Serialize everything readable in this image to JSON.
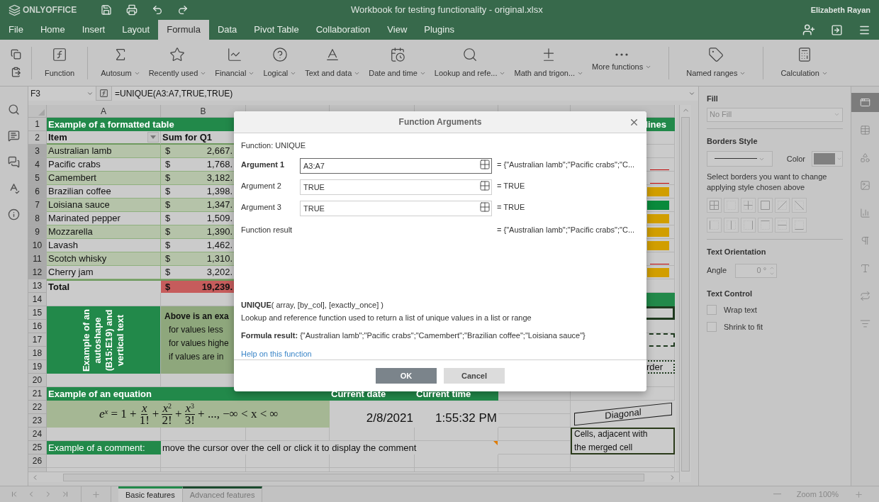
{
  "title_bar": {
    "logo": "ONLYOFFICE",
    "title": "Workbook for testing functionality - original.xlsx",
    "user": "Elizabeth Rayan"
  },
  "menu_tabs": [
    {
      "label": "File",
      "selected": false
    },
    {
      "label": "Home",
      "selected": false
    },
    {
      "label": "Insert",
      "selected": false
    },
    {
      "label": "Layout",
      "selected": false
    },
    {
      "label": "Formula",
      "selected": true
    },
    {
      "label": "Data",
      "selected": false
    },
    {
      "label": "Pivot Table",
      "selected": false
    },
    {
      "label": "Collaboration",
      "selected": false
    },
    {
      "label": "View",
      "selected": false
    },
    {
      "label": "Plugins",
      "selected": false
    }
  ],
  "toolbar": [
    {
      "label": "Function",
      "dropdown": false
    },
    {
      "label": "Autosum",
      "dropdown": true
    },
    {
      "label": "Recently used",
      "dropdown": true
    },
    {
      "label": "Financial",
      "dropdown": true
    },
    {
      "label": "Logical",
      "dropdown": true
    },
    {
      "label": "Text and data",
      "dropdown": true
    },
    {
      "label": "Date and time",
      "dropdown": true
    },
    {
      "label": "Lookup and refe...",
      "dropdown": true
    },
    {
      "label": "Math and trigon...",
      "dropdown": true
    },
    {
      "label": "More functions",
      "dropdown": true
    },
    {
      "label": "Named ranges",
      "dropdown": true
    },
    {
      "label": "Calculation",
      "dropdown": true
    }
  ],
  "formula_bar": {
    "cell": "F3",
    "formula": "=UNIQUE(A3:A7,TRUE,TRUE)"
  },
  "sheet": {
    "columns": [
      {
        "label": "A"
      },
      {
        "label": "B"
      }
    ],
    "rows": [
      {
        "label": "1",
        "selected": false
      },
      {
        "label": "2",
        "selected": false
      },
      {
        "label": "3",
        "selected": true
      },
      {
        "label": "4",
        "selected": true
      },
      {
        "label": "5",
        "selected": true
      },
      {
        "label": "6",
        "selected": true
      },
      {
        "label": "7",
        "selected": true
      },
      {
        "label": "8",
        "selected": true
      },
      {
        "label": "9",
        "selected": true
      },
      {
        "label": "10",
        "selected": true
      },
      {
        "label": "11",
        "selected": true
      },
      {
        "label": "12",
        "selected": true
      },
      {
        "label": "13",
        "selected": false
      },
      {
        "label": "14",
        "selected": false
      },
      {
        "label": "15",
        "selected": false
      },
      {
        "label": "16",
        "selected": false
      },
      {
        "label": "17",
        "selected": false
      },
      {
        "label": "18",
        "selected": false
      },
      {
        "label": "19",
        "selected": false
      },
      {
        "label": "20",
        "selected": false
      },
      {
        "label": "21",
        "selected": false
      },
      {
        "label": "22",
        "selected": false
      },
      {
        "label": "23",
        "selected": false
      },
      {
        "label": "24",
        "selected": false
      },
      {
        "label": "25",
        "selected": false
      },
      {
        "label": "26",
        "selected": false
      }
    ],
    "table_title": "Example of a formatted table",
    "g_heading": "lines",
    "header": {
      "item": "Item",
      "sum": "Sum for Q1"
    },
    "items": [
      {
        "name": "Australian lamb",
        "currency": "$",
        "amount": "2,667."
      },
      {
        "name": "Pacific crabs",
        "currency": "$",
        "amount": "1,768.",
        "g_mark": {
          "kind": "line",
          "color": "#c00000"
        }
      },
      {
        "name": "Camembert",
        "currency": "$",
        "amount": "3,182.",
        "g_mark": {
          "kind": "line",
          "color": "#c00000"
        }
      },
      {
        "name": "Brazilian coffee",
        "currency": "$",
        "amount": "1,398.",
        "g_mark": {
          "kind": "bar",
          "color": "#d19e00"
        }
      },
      {
        "name": "Loisiana sauce",
        "currency": "$",
        "amount": "1,347.",
        "g_mark": {
          "kind": "bar",
          "color": "#0a8a3c"
        }
      },
      {
        "name": "Marinated pepper",
        "currency": "$",
        "amount": "1,509.",
        "g_mark": {
          "kind": "bar",
          "color": "#d19e00"
        }
      },
      {
        "name": "Mozzarella",
        "currency": "$",
        "amount": "1,390.",
        "g_mark": {
          "kind": "bar",
          "color": "#d19e00"
        }
      },
      {
        "name": "Lavash",
        "currency": "$",
        "amount": "1,462.",
        "g_mark": {
          "kind": "bar",
          "color": "#d19e00"
        }
      },
      {
        "name": "Scotch whisky",
        "currency": "$",
        "amount": "1,310.",
        "g_mark": {
          "kind": "line",
          "color": "#c00000"
        }
      },
      {
        "name": "Cherry jam",
        "currency": "$",
        "amount": "3,202.",
        "g_mark": {
          "kind": "bar",
          "color": "#d19e00"
        }
      }
    ],
    "total": {
      "label": "Total",
      "currency": "$",
      "amount": "19,239."
    },
    "g_borders": [
      {
        "kind": "fill"
      },
      {
        "kind": "thick"
      },
      {
        "kind": "dashed"
      },
      {
        "kind": "dash-dot",
        "text": "rder"
      }
    ],
    "vertical_text": "Example of an autoshape (B15:E19) and vertical text",
    "autoshape_lines": [
      {
        "text": "Above is an exa",
        "bold": true
      },
      {
        "text": "for values less",
        "bold": false
      },
      {
        "text": "for values highe",
        "bold": false
      },
      {
        "text": "if values are in",
        "bold": false
      }
    ],
    "equation_heading": "Example of an equation",
    "date_heading": "Current date",
    "time_heading": "Current time",
    "equation": {
      "base": "e",
      "power": "x",
      "lead": "= 1 +",
      "fractions": [
        {
          "num": "x",
          "den": "1!",
          "after": "+"
        },
        {
          "num": "x",
          "exp": "2",
          "den": "2!",
          "after": "+"
        },
        {
          "num": "x",
          "exp": "3",
          "den": "3!",
          "after": "+ ...,  −∞ < x < ∞"
        }
      ]
    },
    "date": "2/8/2021",
    "time": "1:55:32 PM",
    "diagonal": "Diagonal",
    "adjacent": "Cells, adjacent with the merged cell",
    "comment_label": "Example of a comment:",
    "comment_text": "move the cursor over the cell or click it to display the comment",
    "comment_marker": true
  },
  "sheet_tabs": [
    {
      "label": "Basic features",
      "selected": true
    },
    {
      "label": "Advanced features",
      "selected": false
    }
  ],
  "zoom": "Zoom 100%",
  "right_panel": {
    "fill_label": "Fill",
    "fill_value": "No Fill",
    "borders_label": "Borders Style",
    "color_label": "Color",
    "color": "#808080",
    "borders_hint": "Select borders you want to change applying style chosen above",
    "orientation_label": "Text Orientation",
    "angle_label": "Angle",
    "angle": "0 °",
    "text_control_label": "Text Control",
    "options": [
      {
        "label": "Wrap text",
        "checked": false
      },
      {
        "label": "Shrink to fit",
        "checked": false
      }
    ]
  },
  "right_rail": [
    {
      "selected": true
    },
    {
      "selected": false
    },
    {
      "selected": false
    },
    {
      "selected": false
    },
    {
      "selected": false
    },
    {
      "selected": false
    },
    {
      "selected": false
    },
    {
      "selected": false
    },
    {
      "selected": false
    }
  ],
  "dialog": {
    "title": "Function Arguments",
    "function_label": "Function: UNIQUE",
    "arguments": [
      {
        "label": "Argument 1",
        "value": "A3:A7",
        "result": "= {\"Australian lamb\";\"Pacific crabs\";\"C...",
        "focused": true
      },
      {
        "label": "Argument 2",
        "value": "TRUE",
        "result": "= TRUE",
        "focused": false
      },
      {
        "label": "Argument 3",
        "value": "TRUE",
        "result": "= TRUE",
        "focused": false
      }
    ],
    "result_label": "Function result",
    "result": "= {\"Australian lamb\";\"Pacific crabs\";\"C...",
    "syntax": "**UNIQUE**( array, [by_col], [exactly_once] )",
    "description": "Lookup and reference function used to return a list of unique values in a list or range",
    "formula_result": "**Formula result:** {\"Australian lamb\";\"Pacific crabs\";\"Camembert\";\"Brazilian coffee\";\"Loisiana sauce\"}",
    "help_link": "Help on this function",
    "buttons": [
      {
        "label": "OK",
        "kind": "primary"
      },
      {
        "label": "Cancel",
        "kind": "secondary"
      }
    ]
  }
}
